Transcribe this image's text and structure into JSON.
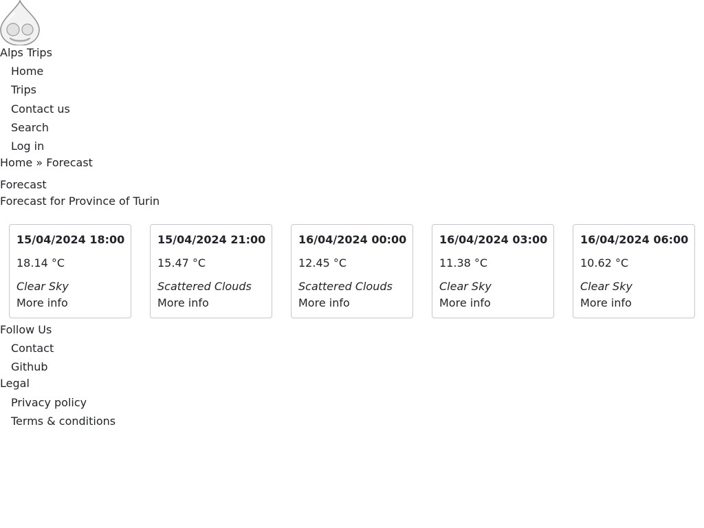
{
  "site": {
    "name": "Alps Trips"
  },
  "nav": {
    "items": [
      {
        "label": "Home"
      },
      {
        "label": "Trips"
      },
      {
        "label": "Contact us"
      },
      {
        "label": "Search"
      },
      {
        "label": "Log in"
      }
    ]
  },
  "breadcrumb": {
    "home": "Home",
    "separator": "»",
    "current": "Forecast"
  },
  "page": {
    "title": "Forecast",
    "subtitle": "Forecast for Province of Turin"
  },
  "forecast": {
    "cards": [
      {
        "datetime": "15/04/2024 18:00",
        "temp": "18.14 °C",
        "condition": "Clear Sky",
        "link": "More info"
      },
      {
        "datetime": "15/04/2024 21:00",
        "temp": "15.47 °C",
        "condition": "Scattered Clouds",
        "link": "More info"
      },
      {
        "datetime": "16/04/2024 00:00",
        "temp": "12.45 °C",
        "condition": "Scattered Clouds",
        "link": "More info"
      },
      {
        "datetime": "16/04/2024 03:00",
        "temp": "11.38 °C",
        "condition": "Clear Sky",
        "link": "More info"
      },
      {
        "datetime": "16/04/2024 06:00",
        "temp": "10.62 °C",
        "condition": "Clear Sky",
        "link": "More info"
      }
    ]
  },
  "footer": {
    "follow_title": "Follow Us",
    "follow_items": [
      {
        "label": "Contact"
      },
      {
        "label": "Github"
      }
    ],
    "legal_title": "Legal",
    "legal_items": [
      {
        "label": "Privacy policy"
      },
      {
        "label": "Terms & conditions"
      }
    ]
  },
  "logo": {
    "icon": "drupal-drop-icon"
  },
  "colors": {
    "text": "#212529",
    "card_border": "#c6c8cb",
    "background": "#ffffff"
  }
}
